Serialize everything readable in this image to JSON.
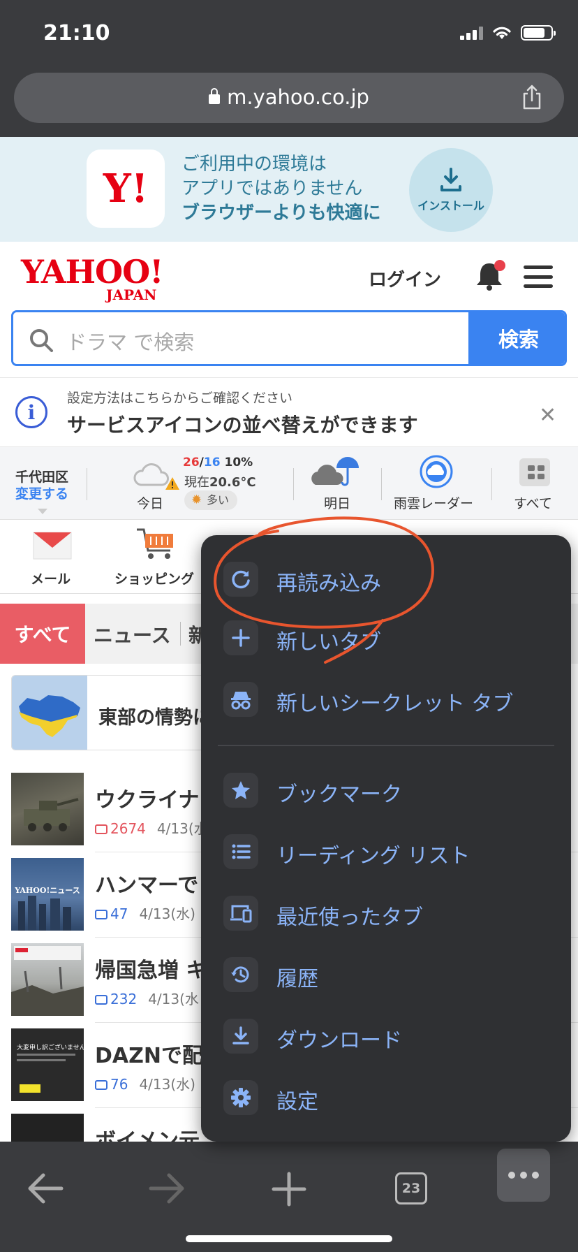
{
  "status_bar": {
    "time": "21:10"
  },
  "url_bar": {
    "domain": "m.yahoo.co.jp"
  },
  "app_banner": {
    "logo_text": "Y!",
    "line1": "ご利用中の環境は",
    "line2": "アプリではありません",
    "line3": "ブラウザーよりも快適に",
    "install_label": "インストール"
  },
  "header": {
    "logo_line1": "YAHOO!",
    "logo_line2": "JAPAN",
    "login": "ログイン"
  },
  "search": {
    "placeholder": "ドラマ で検索",
    "button": "検索"
  },
  "notice": {
    "small": "設定方法はこちらからご確認ください",
    "main": "サービスアイコンの並べ替えができます",
    "close": "✕"
  },
  "weather": {
    "location": "千代田区",
    "change": "変更する",
    "today_label": "今日",
    "high": "26",
    "slash": "/",
    "low": "16",
    "precip": "10%",
    "now_prefix": "現在",
    "now_temp": "20.6°C",
    "pollen": "多い",
    "tomorrow_label": "明日",
    "radar_label": "雨雲レーダー",
    "all_label": "すべて"
  },
  "services": [
    {
      "label": "メール"
    },
    {
      "label": "ショッピング"
    }
  ],
  "category_tabs": {
    "all": "すべて",
    "news": "ニュース",
    "next": "新"
  },
  "feature": {
    "title": "東部の情勢に"
  },
  "news": [
    {
      "title": "ウクライナ",
      "count": "2674",
      "date": "4/13(水"
    },
    {
      "title": "ハンマーで",
      "count": "47",
      "date": "4/13(水)"
    },
    {
      "title": "帰国急増 キ",
      "count": "232",
      "date": "4/13(水"
    },
    {
      "title": "DAZNで配",
      "count": "76",
      "date": "4/13(水)"
    },
    {
      "title": "ボイメン元",
      "count": "",
      "date": ""
    }
  ],
  "news_thumb_text": {
    "yahoo_news": "YAHOO!ニュース",
    "dazn_notice": "大変申し訳ございません"
  },
  "menu": {
    "items": [
      {
        "label": "再読み込み",
        "icon": "reload-icon"
      },
      {
        "label": "新しいタブ",
        "icon": "plus-icon"
      },
      {
        "label": "新しいシークレット タブ",
        "icon": "incognito-icon"
      },
      {
        "label": "ブックマーク",
        "icon": "star-icon"
      },
      {
        "label": "リーディング リスト",
        "icon": "list-icon"
      },
      {
        "label": "最近使ったタブ",
        "icon": "devices-icon"
      },
      {
        "label": "履歴",
        "icon": "history-icon"
      },
      {
        "label": "ダウンロード",
        "icon": "download-icon"
      },
      {
        "label": "設定",
        "icon": "gear-icon"
      }
    ]
  },
  "toolbar": {
    "tab_count": "23"
  },
  "colors": {
    "yahoo_red": "#e60012",
    "link_blue": "#3a83f1",
    "menu_text": "#8bb4f8",
    "annotation": "#e8552e"
  }
}
